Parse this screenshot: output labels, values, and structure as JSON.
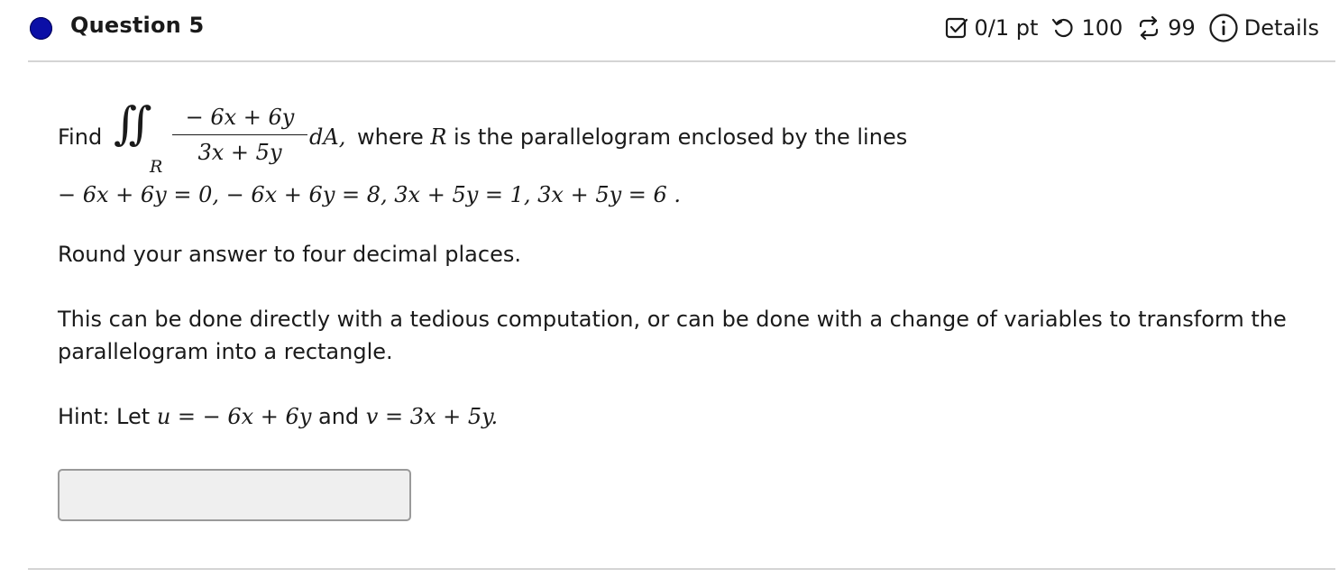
{
  "header": {
    "title": "Question 5",
    "points": "0/1 pt",
    "attempts": "100",
    "retries": "99",
    "details_label": "Details",
    "status_color": "#0b0fa6",
    "icons": [
      "checkbox-icon",
      "undo-icon",
      "retry-icon",
      "info-icon"
    ]
  },
  "question": {
    "find_label": "Find",
    "integral_symbol": "∬",
    "region_subscript": "R",
    "numerator": "− 6x + 6y",
    "denominator": "3x + 5y",
    "differential": "dA,",
    "where_text_pre": "where ",
    "region_var": "R",
    "where_text_post": " is the parallelogram enclosed by the lines",
    "lines": "− 6x + 6y = 0,   − 6x + 6y = 8,  3x + 5y = 1,  3x + 5y = 6 .",
    "round_instruction": "Round your answer to four decimal places.",
    "method_note": "This can be done directly with a tedious computation, or can be done with a change of variables to transform the parallelogram into a rectangle.",
    "hint_label": "Hint: Let ",
    "hint_u": "u  =    − 6x + 6y",
    "hint_and": " and ",
    "hint_v": "v  =  3x + 5y."
  },
  "answer": {
    "value": "",
    "placeholder": ""
  }
}
